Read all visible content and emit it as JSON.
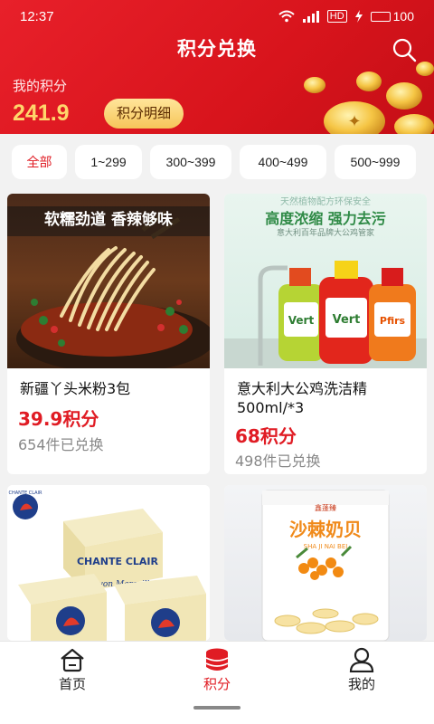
{
  "status_bar": {
    "time": "12:37",
    "network": "4G",
    "hd": "HD",
    "battery": "100"
  },
  "header": {
    "title": "积分兑换",
    "points_label": "我的积分",
    "points_value": "241.9",
    "detail_button": "积分明细"
  },
  "filters": [
    {
      "label": "全部",
      "active": true
    },
    {
      "label": "1~299",
      "active": false
    },
    {
      "label": "300~399",
      "active": false
    },
    {
      "label": "400~499",
      "active": false
    },
    {
      "label": "500~999",
      "active": false
    }
  ],
  "products": [
    {
      "title": "新疆丫头米粉3包",
      "price": "39.9积分",
      "sold": "654件已兑换",
      "banner": "软糯劲道  香辣够味"
    },
    {
      "title": "意大利大公鸡洗洁精500ml/*3",
      "title_line1": "意大利大公鸡洗洁精",
      "title_line2": "500ml/*3",
      "price": "68积分",
      "sold": "498件已兑换",
      "banner_top": "天然植物配方环保安全",
      "banner_main": "高度浓缩  强力去污",
      "banner_sub": "意大利百年品牌大公鸡管家",
      "bottle_labels": [
        "Vert",
        "Vert",
        "Pfirs"
      ]
    },
    {
      "title": "",
      "brand": "CHANTE CLAIR",
      "soap_text": "Savon Marseille"
    },
    {
      "title": "",
      "brand_cn": "沙棘奶贝",
      "brand_pinyin": "SHA JI NAI BEI",
      "logo": "鑫蓬臻"
    }
  ],
  "bottom_nav": [
    {
      "label": "首页",
      "icon": "home-icon",
      "active": false
    },
    {
      "label": "积分",
      "icon": "points-icon",
      "active": true
    },
    {
      "label": "我的",
      "icon": "profile-icon",
      "active": false
    }
  ],
  "colors": {
    "brand_red": "#e01c24",
    "gold": "#ffd66b"
  }
}
